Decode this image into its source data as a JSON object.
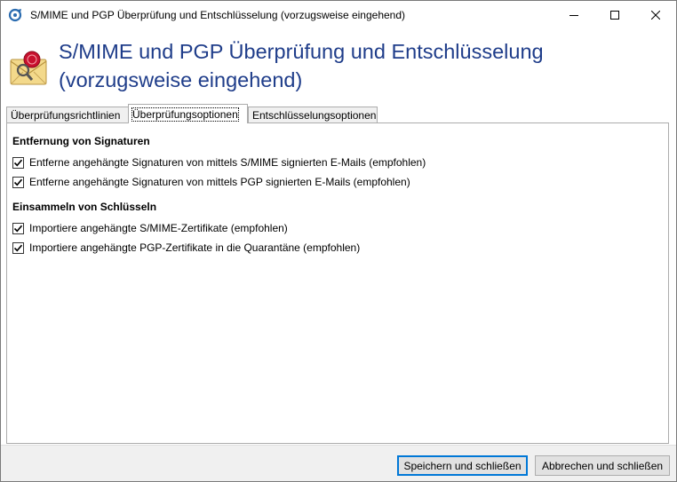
{
  "window": {
    "title": "S/MIME und PGP Überprüfung und Entschlüsselung (vorzugsweise eingehend)"
  },
  "header": {
    "title_line1": "S/MIME und PGP Überprüfung und Entschlüsselung",
    "title_line2": "(vorzugsweise eingehend)"
  },
  "tabs": [
    {
      "label": "Überprüfungsrichtlinien",
      "active": false
    },
    {
      "label": "Überprüfungsoptionen",
      "active": true
    },
    {
      "label": "Entschlüsselungsoptionen",
      "active": false
    }
  ],
  "sections": [
    {
      "title": "Entfernung von Signaturen",
      "options": [
        {
          "label": "Entferne angehängte Signaturen von mittels S/MIME signierten E-Mails (empfohlen)",
          "checked": true
        },
        {
          "label": "Entferne angehängte Signaturen von mittels PGP signierten E-Mails (empfohlen)",
          "checked": true
        }
      ]
    },
    {
      "title": "Einsammeln von Schlüsseln",
      "options": [
        {
          "label": "Importiere angehängte S/MIME-Zertifikate (empfohlen)",
          "checked": true
        },
        {
          "label": "Importiere angehängte PGP-Zertifikate in die Quarantäne (empfohlen)",
          "checked": true
        }
      ]
    }
  ],
  "footer": {
    "save_label": "Speichern und schließen",
    "cancel_label": "Abbrechen und schließen"
  },
  "colors": {
    "header_title": "#1f3d8a",
    "default_button_border": "#0078d7"
  }
}
